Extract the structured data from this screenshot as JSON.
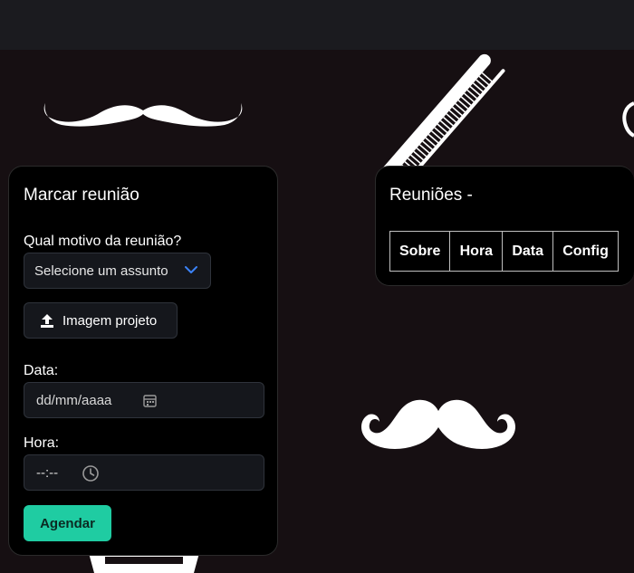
{
  "form": {
    "title": "Marcar reunião",
    "reason_label": "Qual motivo da reunião?",
    "reason_select_value": "Selecione um assunto",
    "upload_label": "Imagem projeto",
    "date_label": "Data:",
    "date_value": "dd/mm/aaaa",
    "time_label": "Hora:",
    "time_value": "--:--",
    "submit_label": "Agendar"
  },
  "meetings": {
    "title": "Reuniões -",
    "columns": [
      "Sobre",
      "Hora",
      "Data",
      "Config"
    ]
  },
  "colors": {
    "background": "#160f12",
    "panel": "#000000",
    "accent": "#1fcca2",
    "chevron": "#3b82f6"
  },
  "icons": [
    "chevron-down-icon",
    "upload-icon",
    "calendar-icon",
    "clock-icon",
    "mustache-icon",
    "comb-icon"
  ]
}
